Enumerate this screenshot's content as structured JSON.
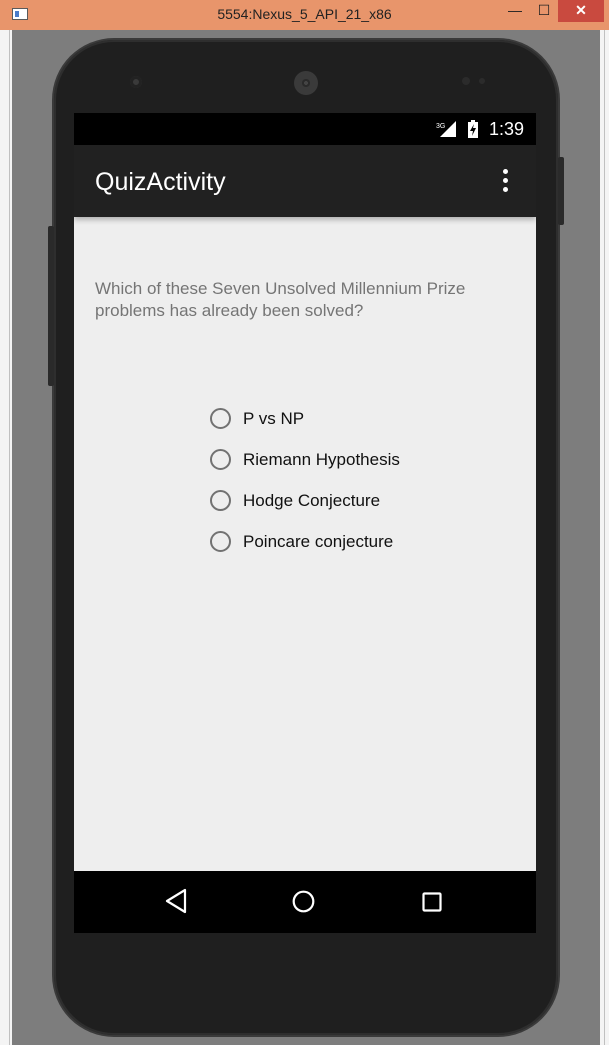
{
  "window": {
    "title": "5554:Nexus_5_API_21_x86",
    "min": "—",
    "max": "☐",
    "close": "✕"
  },
  "statusbar": {
    "network": "3G",
    "time": "1:39"
  },
  "appbar": {
    "title": "QuizActivity",
    "overflow_icon": "more-vert-icon"
  },
  "quiz": {
    "question": "Which of these Seven Unsolved Millennium Prize problems has already been solved?",
    "options": [
      "P vs NP",
      "Riemann Hypothesis",
      "Hodge Conjecture",
      "Poincare conjecture"
    ],
    "selected": null
  },
  "navbar": {
    "back_icon": "back-icon",
    "home_icon": "home-icon",
    "recents_icon": "recents-icon"
  },
  "colors": {
    "window_frame": "#e8956b",
    "appbar": "#212121",
    "screen_bg": "#eeeeee",
    "question_text": "#757575",
    "radio": "#727272"
  }
}
